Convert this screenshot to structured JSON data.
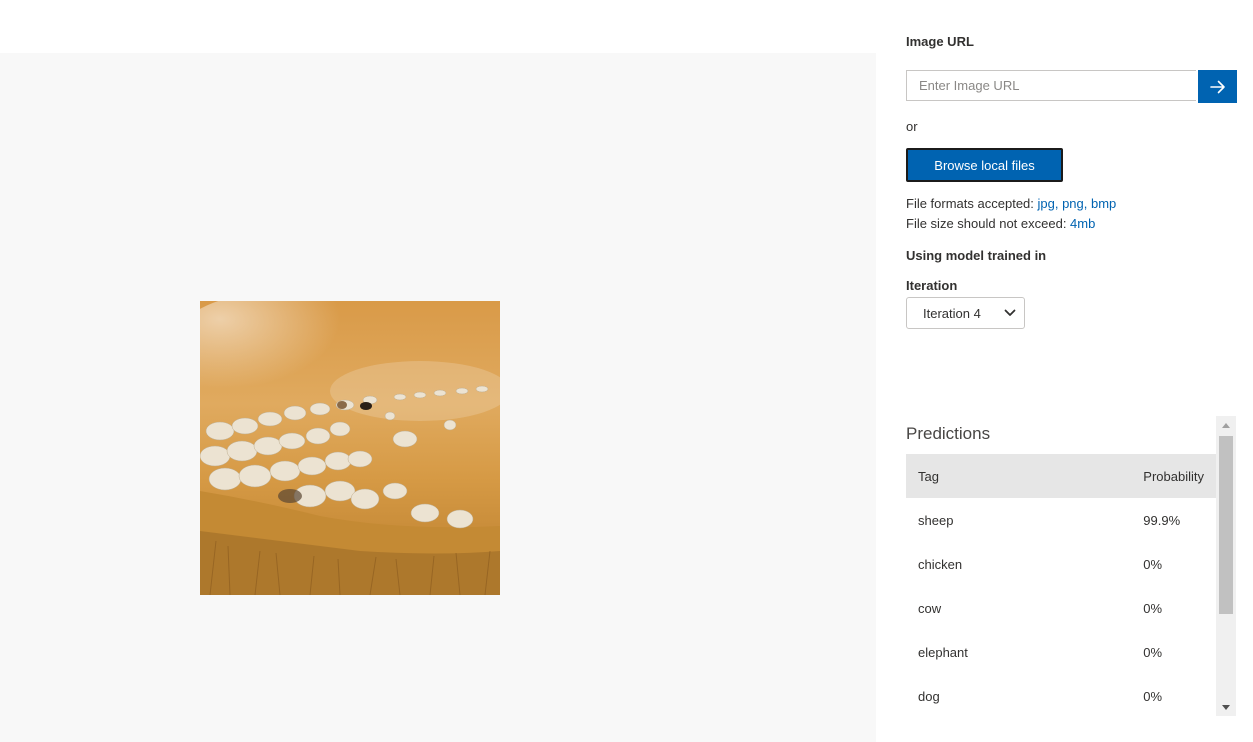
{
  "preview": {
    "image_subject": "flock of sheep grazing on dry golden grass field"
  },
  "url_section": {
    "label": "Image URL",
    "placeholder": "Enter Image URL",
    "go_icon": "arrow-right-icon"
  },
  "or_text": "or",
  "browse_button": "Browse local files",
  "file_info": {
    "formats_prefix": "File formats accepted: ",
    "formats": "jpg, png, bmp",
    "size_prefix": "File size should not exceed: ",
    "size": "4mb"
  },
  "model_label": "Using model trained in",
  "iteration": {
    "label": "Iteration",
    "selected": "Iteration 4"
  },
  "predictions": {
    "title": "Predictions",
    "columns": [
      "Tag",
      "Probability"
    ],
    "rows": [
      {
        "tag": "sheep",
        "probability": "99.9%"
      },
      {
        "tag": "chicken",
        "probability": "0%"
      },
      {
        "tag": "cow",
        "probability": "0%"
      },
      {
        "tag": "elephant",
        "probability": "0%"
      },
      {
        "tag": "dog",
        "probability": "0%"
      }
    ]
  },
  "colors": {
    "accent": "#0063b1",
    "preview_bg": "#f8f8f8",
    "header_bg": "#e6e6e6"
  }
}
